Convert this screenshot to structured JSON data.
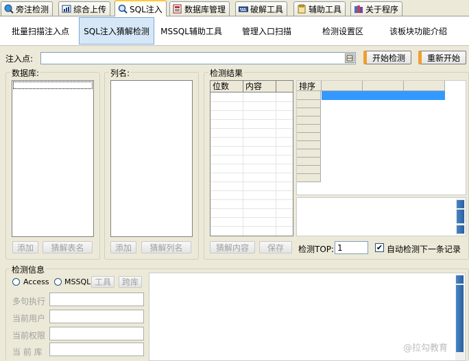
{
  "tabs": [
    {
      "label": "旁注检测",
      "icon": "globe-search-icon",
      "active": false
    },
    {
      "label": "综合上传",
      "icon": "chart-icon",
      "active": false
    },
    {
      "label": "SQL注入",
      "icon": "magnifier-icon",
      "active": true
    },
    {
      "label": "数据库管理",
      "icon": "database-icon",
      "active": false
    },
    {
      "label": "破解工具",
      "icon": "keyboard-icon",
      "active": false
    },
    {
      "label": "辅助工具",
      "icon": "clipboard-icon",
      "active": false
    },
    {
      "label": "关于程序",
      "icon": "books-icon",
      "active": false
    }
  ],
  "subtabs": [
    "批量扫描注入点",
    "SQL注入猜解检测",
    "MSSQL辅助工具",
    "管理入口扫描",
    "检测设置区",
    "该板块功能介绍"
  ],
  "injection": {
    "label": "注入点:",
    "value": "",
    "start_button": "开始检测",
    "restart_button": "重新开始"
  },
  "database_group": {
    "title": "数据库:",
    "add_button": "添加",
    "guess_button": "猜解表名"
  },
  "columns_group": {
    "title": "列名:",
    "add_button": "添加",
    "guess_button": "猜解列名"
  },
  "result_group": {
    "title": "检测结果",
    "col_position": "位数",
    "col_content": "内容",
    "sort_header": "排序",
    "guess_content_button": "猜解内容",
    "save_button": "保存",
    "top_label": "检测TOP:",
    "top_value": "1",
    "auto_detect_label": "自动检测下一条记录",
    "auto_detect_checked": true
  },
  "info_group": {
    "title": "检测信息",
    "radio_access": "Access",
    "radio_mssql": "MSSQL",
    "tool_button": "工具",
    "cross_db_button": "跨库",
    "multi_exec_label": "多句执行",
    "current_user_label": "当前用户",
    "current_perm_label": "当前权限",
    "current_db_label": "当 前 库"
  },
  "watermark": "@拉勾教育",
  "colors": {
    "accent": "#f0a030",
    "selection": "#3399ff",
    "active_subtab": "#d6e8f8"
  }
}
